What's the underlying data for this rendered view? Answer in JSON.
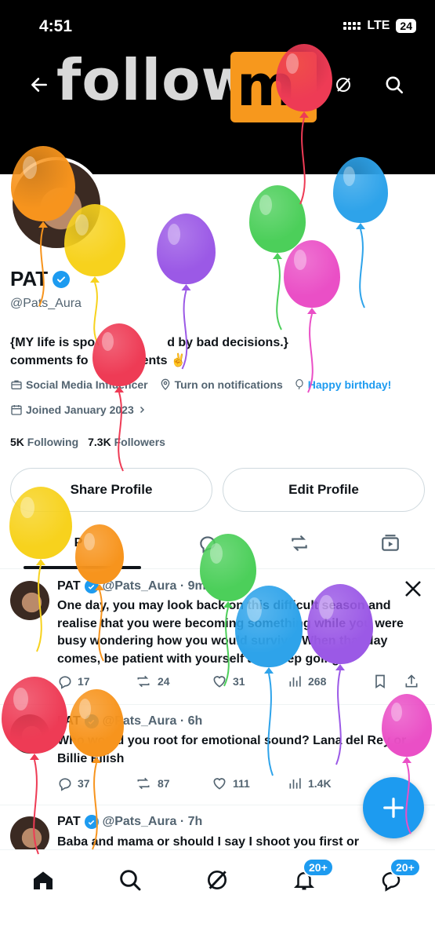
{
  "status_bar": {
    "time": "4:51",
    "network": "LTE",
    "battery": "24"
  },
  "banner": {
    "text": "follow",
    "box_letter": "m"
  },
  "profile": {
    "name": "PAT",
    "handle": "@Pats_Aura",
    "bio_line1": "{MY life is spo",
    "bio_line1_tail": "d by bad decisions.}",
    "bio_line2": "comments fo",
    "bio_line2_tail": "ents ✌",
    "category": "Social Media Influencer",
    "notifications": "Turn on notifications",
    "birthday": "Happy birthday!",
    "joined": "Joined January 2023",
    "following_count": "5K",
    "following_label": "Following",
    "followers_count": "7.3K",
    "followers_label": "Followers"
  },
  "buttons": {
    "share": "Share Profile",
    "edit": "Edit Profile"
  },
  "tabs": {
    "posts": "P"
  },
  "posts": [
    {
      "name": "PAT",
      "handle": "@Pats_Aura · 9m",
      "text": "One day, you may look back on this difficult season and realise that you were becoming something while you were busy wondering how you would survive. When that day comes, be patient with yourself and keep going.",
      "replies": "17",
      "reposts": "24",
      "likes": "31",
      "views": "268"
    },
    {
      "name": "PAT",
      "handle": "@Pats_Aura · 6h",
      "text": "Who would you root for emotional sound? Lana del Rey or Billie Eilish",
      "replies": "37",
      "reposts": "87",
      "likes": "111",
      "views": "1.4K"
    },
    {
      "name": "PAT",
      "handle": "@Pats_Aura · 7h",
      "text": "Baba and mama or should I say I shoot you first or"
    }
  ],
  "nav": {
    "notifications_badge": "20+",
    "messages_badge": "20+"
  },
  "colors": {
    "accent": "#1d9bf0",
    "banner_bg": "#000000",
    "box": "#f7981d"
  }
}
